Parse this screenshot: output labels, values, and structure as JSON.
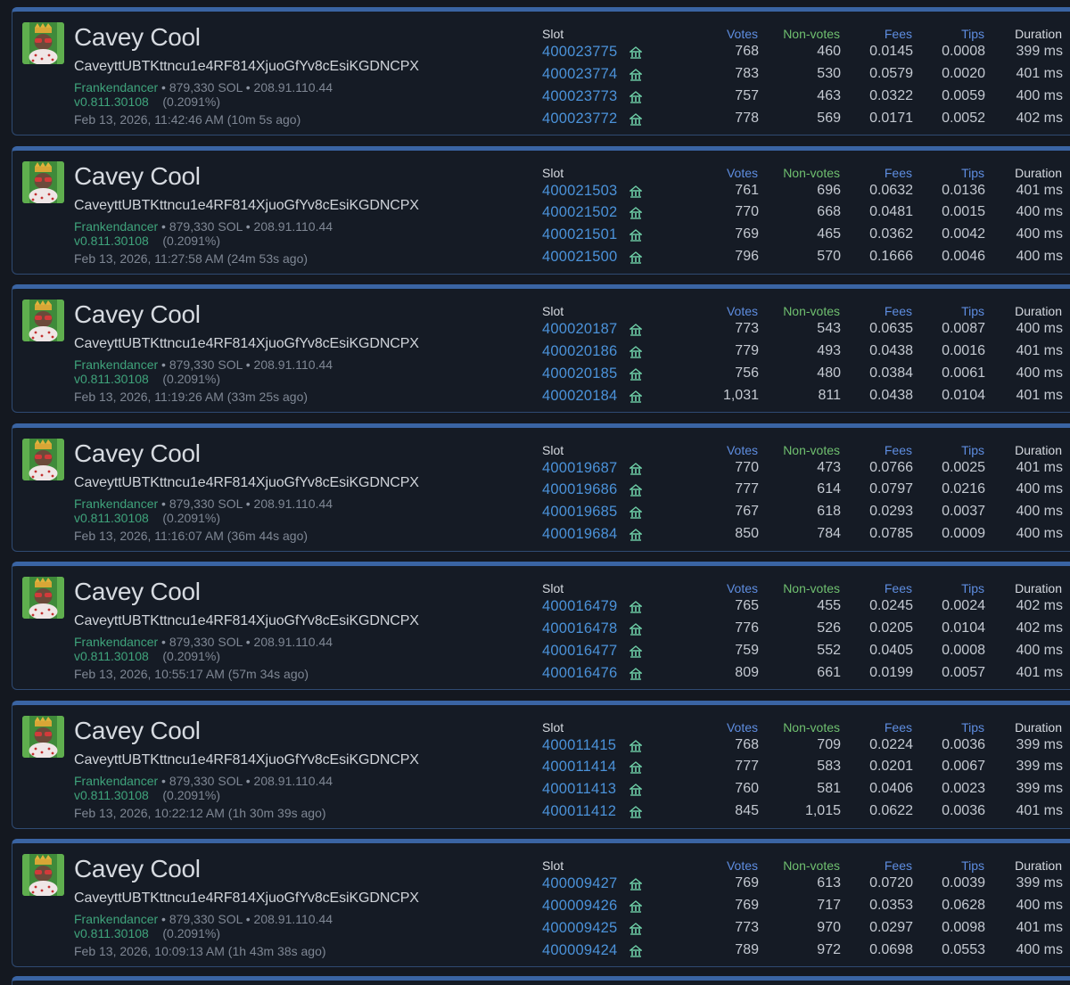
{
  "headers": {
    "slot": "Slot",
    "votes": "Votes",
    "nonvotes": "Non-votes",
    "fees": "Fees",
    "tips": "Tips",
    "duration": "Duration"
  },
  "colors": {
    "accent_blue": "#4b92d9",
    "client_green": "#3fa37b",
    "card_border": "#3a64a3",
    "background": "#141820"
  },
  "icons": {
    "avatar": "validator-avatar-image",
    "slot": "leader-schedule-icon"
  },
  "cards": [
    {
      "name": "Cavey Cool",
      "pubkey": "CaveyttUBTKttncu1e4RF814XjuoGfYv8cEsiKGDNCPX",
      "client": "Frankendancer",
      "stake": "879,330 SOL",
      "ip": "208.91.110.44",
      "version": "v0.811.30108",
      "stake_pct": "(0.2091%)",
      "timestamp": "Feb 13, 2026, 11:42:46 AM (10m 5s ago)",
      "rows": [
        {
          "slot": "400023775",
          "votes": "768",
          "nonvotes": "460",
          "fees": "0.0145",
          "tips": "0.0008",
          "duration": "399 ms"
        },
        {
          "slot": "400023774",
          "votes": "783",
          "nonvotes": "530",
          "fees": "0.0579",
          "tips": "0.0020",
          "duration": "401 ms"
        },
        {
          "slot": "400023773",
          "votes": "757",
          "nonvotes": "463",
          "fees": "0.0322",
          "tips": "0.0059",
          "duration": "400 ms"
        },
        {
          "slot": "400023772",
          "votes": "778",
          "nonvotes": "569",
          "fees": "0.0171",
          "tips": "0.0052",
          "duration": "402 ms"
        }
      ]
    },
    {
      "name": "Cavey Cool",
      "pubkey": "CaveyttUBTKttncu1e4RF814XjuoGfYv8cEsiKGDNCPX",
      "client": "Frankendancer",
      "stake": "879,330 SOL",
      "ip": "208.91.110.44",
      "version": "v0.811.30108",
      "stake_pct": "(0.2091%)",
      "timestamp": "Feb 13, 2026, 11:27:58 AM (24m 53s ago)",
      "rows": [
        {
          "slot": "400021503",
          "votes": "761",
          "nonvotes": "696",
          "fees": "0.0632",
          "tips": "0.0136",
          "duration": "401 ms"
        },
        {
          "slot": "400021502",
          "votes": "770",
          "nonvotes": "668",
          "fees": "0.0481",
          "tips": "0.0015",
          "duration": "400 ms"
        },
        {
          "slot": "400021501",
          "votes": "769",
          "nonvotes": "465",
          "fees": "0.0362",
          "tips": "0.0042",
          "duration": "400 ms"
        },
        {
          "slot": "400021500",
          "votes": "796",
          "nonvotes": "570",
          "fees": "0.1666",
          "tips": "0.0046",
          "duration": "400 ms"
        }
      ]
    },
    {
      "name": "Cavey Cool",
      "pubkey": "CaveyttUBTKttncu1e4RF814XjuoGfYv8cEsiKGDNCPX",
      "client": "Frankendancer",
      "stake": "879,330 SOL",
      "ip": "208.91.110.44",
      "version": "v0.811.30108",
      "stake_pct": "(0.2091%)",
      "timestamp": "Feb 13, 2026, 11:19:26 AM (33m 25s ago)",
      "rows": [
        {
          "slot": "400020187",
          "votes": "773",
          "nonvotes": "543",
          "fees": "0.0635",
          "tips": "0.0087",
          "duration": "400 ms"
        },
        {
          "slot": "400020186",
          "votes": "779",
          "nonvotes": "493",
          "fees": "0.0438",
          "tips": "0.0016",
          "duration": "401 ms"
        },
        {
          "slot": "400020185",
          "votes": "756",
          "nonvotes": "480",
          "fees": "0.0384",
          "tips": "0.0061",
          "duration": "400 ms"
        },
        {
          "slot": "400020184",
          "votes": "1,031",
          "nonvotes": "811",
          "fees": "0.0438",
          "tips": "0.0104",
          "duration": "401 ms"
        }
      ]
    },
    {
      "name": "Cavey Cool",
      "pubkey": "CaveyttUBTKttncu1e4RF814XjuoGfYv8cEsiKGDNCPX",
      "client": "Frankendancer",
      "stake": "879,330 SOL",
      "ip": "208.91.110.44",
      "version": "v0.811.30108",
      "stake_pct": "(0.2091%)",
      "timestamp": "Feb 13, 2026, 11:16:07 AM (36m 44s ago)",
      "rows": [
        {
          "slot": "400019687",
          "votes": "770",
          "nonvotes": "473",
          "fees": "0.0766",
          "tips": "0.0025",
          "duration": "401 ms"
        },
        {
          "slot": "400019686",
          "votes": "777",
          "nonvotes": "614",
          "fees": "0.0797",
          "tips": "0.0216",
          "duration": "400 ms"
        },
        {
          "slot": "400019685",
          "votes": "767",
          "nonvotes": "618",
          "fees": "0.0293",
          "tips": "0.0037",
          "duration": "400 ms"
        },
        {
          "slot": "400019684",
          "votes": "850",
          "nonvotes": "784",
          "fees": "0.0785",
          "tips": "0.0009",
          "duration": "400 ms"
        }
      ]
    },
    {
      "name": "Cavey Cool",
      "pubkey": "CaveyttUBTKttncu1e4RF814XjuoGfYv8cEsiKGDNCPX",
      "client": "Frankendancer",
      "stake": "879,330 SOL",
      "ip": "208.91.110.44",
      "version": "v0.811.30108",
      "stake_pct": "(0.2091%)",
      "timestamp": "Feb 13, 2026, 10:55:17 AM (57m 34s ago)",
      "rows": [
        {
          "slot": "400016479",
          "votes": "765",
          "nonvotes": "455",
          "fees": "0.0245",
          "tips": "0.0024",
          "duration": "402 ms"
        },
        {
          "slot": "400016478",
          "votes": "776",
          "nonvotes": "526",
          "fees": "0.0205",
          "tips": "0.0104",
          "duration": "402 ms"
        },
        {
          "slot": "400016477",
          "votes": "759",
          "nonvotes": "552",
          "fees": "0.0405",
          "tips": "0.0008",
          "duration": "400 ms"
        },
        {
          "slot": "400016476",
          "votes": "809",
          "nonvotes": "661",
          "fees": "0.0199",
          "tips": "0.0057",
          "duration": "401 ms"
        }
      ]
    },
    {
      "name": "Cavey Cool",
      "pubkey": "CaveyttUBTKttncu1e4RF814XjuoGfYv8cEsiKGDNCPX",
      "client": "Frankendancer",
      "stake": "879,330 SOL",
      "ip": "208.91.110.44",
      "version": "v0.811.30108",
      "stake_pct": "(0.2091%)",
      "timestamp": "Feb 13, 2026, 10:22:12 AM (1h 30m 39s ago)",
      "rows": [
        {
          "slot": "400011415",
          "votes": "768",
          "nonvotes": "709",
          "fees": "0.0224",
          "tips": "0.0036",
          "duration": "399 ms"
        },
        {
          "slot": "400011414",
          "votes": "777",
          "nonvotes": "583",
          "fees": "0.0201",
          "tips": "0.0067",
          "duration": "399 ms"
        },
        {
          "slot": "400011413",
          "votes": "760",
          "nonvotes": "581",
          "fees": "0.0406",
          "tips": "0.0023",
          "duration": "399 ms"
        },
        {
          "slot": "400011412",
          "votes": "845",
          "nonvotes": "1,015",
          "fees": "0.0622",
          "tips": "0.0036",
          "duration": "401 ms"
        }
      ]
    },
    {
      "name": "Cavey Cool",
      "pubkey": "CaveyttUBTKttncu1e4RF814XjuoGfYv8cEsiKGDNCPX",
      "client": "Frankendancer",
      "stake": "879,330 SOL",
      "ip": "208.91.110.44",
      "version": "v0.811.30108",
      "stake_pct": "(0.2091%)",
      "timestamp": "Feb 13, 2026, 10:09:13 AM (1h 43m 38s ago)",
      "rows": [
        {
          "slot": "400009427",
          "votes": "769",
          "nonvotes": "613",
          "fees": "0.0720",
          "tips": "0.0039",
          "duration": "399 ms"
        },
        {
          "slot": "400009426",
          "votes": "769",
          "nonvotes": "717",
          "fees": "0.0353",
          "tips": "0.0628",
          "duration": "400 ms"
        },
        {
          "slot": "400009425",
          "votes": "773",
          "nonvotes": "970",
          "fees": "0.0297",
          "tips": "0.0098",
          "duration": "401 ms"
        },
        {
          "slot": "400009424",
          "votes": "789",
          "nonvotes": "972",
          "fees": "0.0698",
          "tips": "0.0553",
          "duration": "400 ms"
        }
      ]
    }
  ]
}
